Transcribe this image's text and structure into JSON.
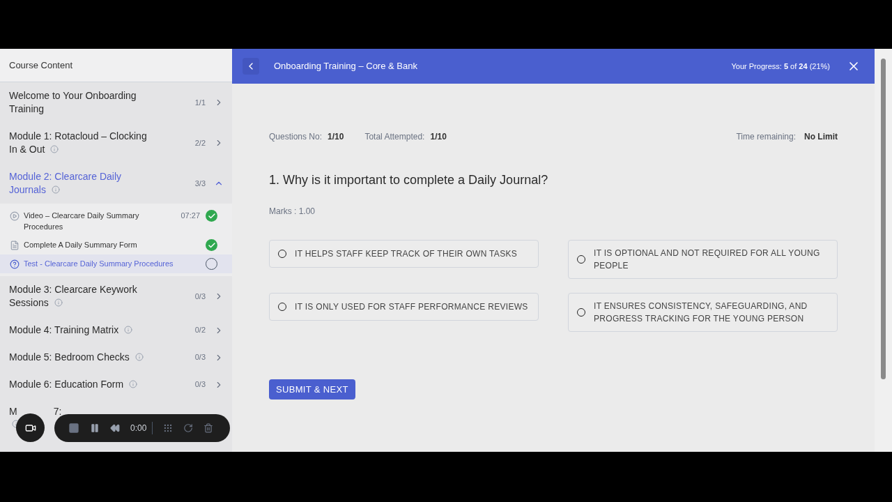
{
  "sidebar": {
    "title": "Course Content",
    "modules": [
      {
        "title": "Welcome to Your Onboarding Training",
        "count": "1/1",
        "info": false,
        "expanded": false,
        "selected": false
      },
      {
        "title": "Module 1: Rotacloud – Clocking In & Out",
        "count": "2/2",
        "info": true,
        "expanded": false,
        "selected": false
      },
      {
        "title": "Module 2: Clearcare Daily Journals",
        "count": "3/3",
        "info": true,
        "expanded": true,
        "selected": true,
        "lessons": [
          {
            "kind": "video",
            "title": "Video – Clearcare Daily Summary Procedures",
            "duration": "07:27",
            "complete": true,
            "selected": false
          },
          {
            "kind": "form",
            "title": "Complete A Daily Summary Form",
            "complete": true,
            "selected": false
          },
          {
            "kind": "test",
            "title": "Test - Clearcare Daily Summary Procedures",
            "complete": false,
            "selected": true
          }
        ]
      },
      {
        "title": "Module 3: Clearcare Keywork Sessions",
        "count": "0/3",
        "info": true,
        "expanded": false,
        "selected": false
      },
      {
        "title": "Module 4: Training Matrix",
        "count": "0/2",
        "info": true,
        "expanded": false,
        "selected": false
      },
      {
        "title": "Module 5: Bedroom Checks",
        "count": "0/3",
        "info": true,
        "expanded": false,
        "selected": false
      },
      {
        "title": "Module 6: Education Form",
        "count": "0/3",
        "info": true,
        "expanded": false,
        "selected": false
      }
    ],
    "partial_module": {
      "visible_parts": [
        "M",
        "7:"
      ],
      "info": true
    }
  },
  "header": {
    "title": "Onboarding Training – Core & Bank",
    "progress": "Your Progress: **5** of **24** (21%)"
  },
  "quiz": {
    "stats": [
      {
        "label": "Questions No:",
        "value": "1/10"
      },
      {
        "label": "Total Attempted:",
        "value": "1/10"
      }
    ],
    "time": {
      "label": "Time remaining:",
      "value": "No Limit"
    },
    "question": "1. Why is it important to complete a Daily Journal?",
    "marks": "Marks : 1.00",
    "options": [
      {
        "text": "IT HELPS STAFF KEEP TRACK OF THEIR OWN TASKS",
        "selected": false
      },
      {
        "text": "IT IS OPTIONAL AND NOT REQUIRED FOR ALL YOUNG PEOPLE",
        "selected": false
      },
      {
        "text": "IT IS ONLY USED FOR STAFF PERFORMANCE REVIEWS",
        "selected": false
      },
      {
        "text": "IT ENSURES CONSISTENCY, SAFEGUARDING, AND PROGRESS TRACKING FOR THE YOUNG PERSON",
        "selected": false
      }
    ],
    "submit": "SUBMIT & NEXT"
  },
  "recorder": {
    "time": "0:00"
  }
}
